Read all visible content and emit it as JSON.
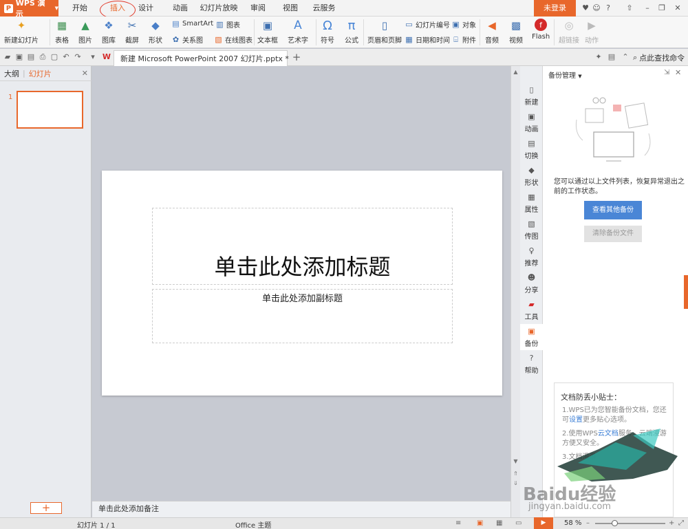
{
  "app": {
    "name": "WPS 演示",
    "login": "未登录"
  },
  "menu": {
    "tabs": [
      "开始",
      "插入",
      "设计",
      "动画",
      "幻灯片放映",
      "审阅",
      "视图",
      "云服务"
    ],
    "active": "插入"
  },
  "ribbon": {
    "new_slide": "新建幻灯片",
    "table": "表格",
    "picture": "图片",
    "gallery": "图库",
    "screenshot": "截屏",
    "shape": "形状",
    "smartart": "SmartArt",
    "chart": "图表",
    "relation": "关系图",
    "online_chart": "在线图表",
    "textbox": "文本框",
    "wordart": "艺术字",
    "symbol": "符号",
    "formula": "公式",
    "header_footer": "页眉和页脚",
    "slide_number": "幻灯片编号",
    "object": "对象",
    "date_time": "日期和时间",
    "attachment": "附件",
    "audio": "音频",
    "video": "视频",
    "flash": "Flash",
    "hyperlink": "超链接",
    "action": "动作"
  },
  "document": {
    "tab_title": "新建 Microsoft PowerPoint 2007 幻灯片.pptx *",
    "find_command": "点此查找命令"
  },
  "left_panel": {
    "tab_outline": "大纲",
    "tab_slides": "幻灯片",
    "slide_number": "1"
  },
  "slide": {
    "title_placeholder": "单击此处添加标题",
    "subtitle_placeholder": "单击此处添加副标题"
  },
  "notes_placeholder": "单击此处添加备注",
  "right_strip": [
    "新建",
    "动画",
    "切换",
    "形状",
    "属性",
    "传图",
    "推荐",
    "分享",
    "工具",
    "备份",
    "帮助"
  ],
  "right_strip_active": "备份",
  "backup_panel": {
    "title": "备份管理",
    "description": "您可以通过以上文件列表，恢复异常退出之前的工作状态。",
    "view_other": "查看其他备份",
    "clear_files": "清除备份文件",
    "tips_title": "文档防丢小贴士：",
    "tip1_a": "1.WPS已为您智能备份文档，您还可",
    "tip1_link": "设置",
    "tip1_b": "更多贴心选项。",
    "tip2_a": "2.使用WPS",
    "tip2_link": "云文档",
    "tip2_b": "服务，云端漫游方便又安全。",
    "tip3": "3.文档漫游"
  },
  "status": {
    "slide_count": "幻灯片 1 / 1",
    "theme": "Office 主题",
    "zoom": "58 %"
  },
  "zoom_fraction": 0.27,
  "colors": {
    "accent": "#e8672b",
    "primary_button": "#4a86d6"
  },
  "watermark": {
    "logo": "Baidu经验",
    "url": "jingyan.baidu.com"
  }
}
